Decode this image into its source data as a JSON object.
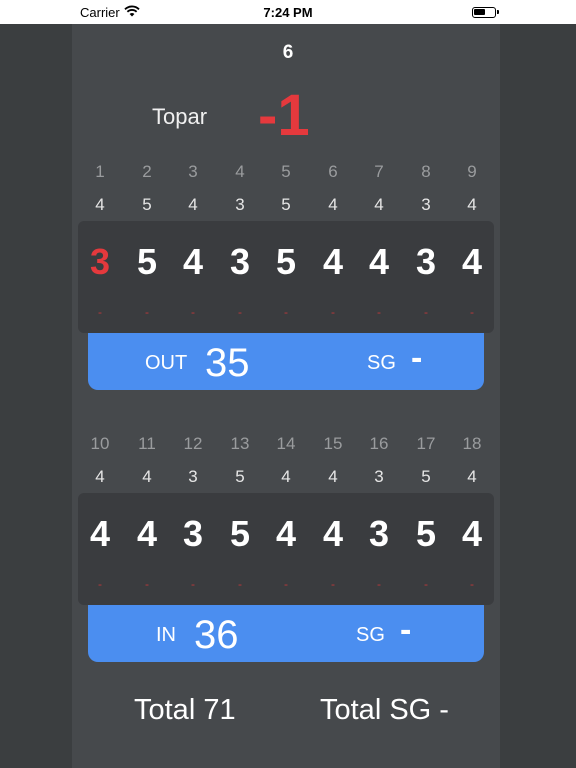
{
  "status": {
    "carrier": "Carrier",
    "time": "7:24 PM"
  },
  "hole_number": "6",
  "topar": {
    "label": "Topar",
    "value": "-1"
  },
  "front": {
    "holes": [
      "1",
      "2",
      "3",
      "4",
      "5",
      "6",
      "7",
      "8",
      "9"
    ],
    "pars": [
      "4",
      "5",
      "4",
      "3",
      "5",
      "4",
      "4",
      "3",
      "4"
    ],
    "scores": [
      "3",
      "5",
      "4",
      "3",
      "5",
      "4",
      "4",
      "3",
      "4"
    ],
    "sg": [
      "-",
      "-",
      "-",
      "-",
      "-",
      "-",
      "-",
      "-",
      "-"
    ],
    "summary": {
      "label": "OUT",
      "value": "35",
      "sg_label": "SG",
      "sg_value": "-"
    }
  },
  "back": {
    "holes": [
      "10",
      "11",
      "12",
      "13",
      "14",
      "15",
      "16",
      "17",
      "18"
    ],
    "pars": [
      "4",
      "4",
      "3",
      "5",
      "4",
      "4",
      "3",
      "5",
      "4"
    ],
    "scores": [
      "4",
      "4",
      "3",
      "5",
      "4",
      "4",
      "3",
      "5",
      "4"
    ],
    "sg": [
      "-",
      "-",
      "-",
      "-",
      "-",
      "-",
      "-",
      "-",
      "-"
    ],
    "summary": {
      "label": "IN",
      "value": "36",
      "sg_label": "SG",
      "sg_value": "-"
    }
  },
  "totals": {
    "total": "Total 71",
    "total_sg": "Total SG -"
  },
  "colors": {
    "accent": "#4b8ef0",
    "under_par": "#e5393d",
    "background": "#3d4042"
  }
}
